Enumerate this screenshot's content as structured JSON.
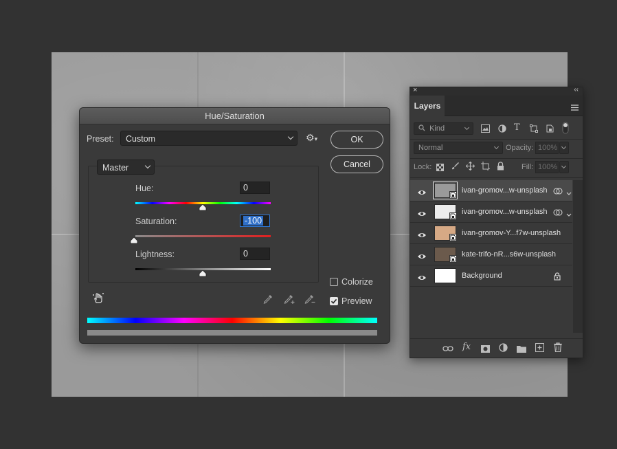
{
  "dialog": {
    "title": "Hue/Saturation",
    "preset_label": "Preset:",
    "preset_value": "Custom",
    "channel_value": "Master",
    "ok_label": "OK",
    "cancel_label": "Cancel",
    "hue_label": "Hue:",
    "hue_value": "0",
    "saturation_label": "Saturation:",
    "saturation_value": "-100",
    "lightness_label": "Lightness:",
    "lightness_value": "0",
    "colorize_label": "Colorize",
    "colorize_checked": false,
    "preview_label": "Preview",
    "preview_checked": true
  },
  "layers_panel": {
    "tab_label": "Layers",
    "filter_kind": "Kind",
    "blend_mode": "Normal",
    "opacity_label": "Opacity:",
    "opacity_value": "100%",
    "lock_label": "Lock:",
    "fill_label": "Fill:",
    "fill_value": "100%",
    "layers": [
      {
        "name": "ivan-gromov...w-unsplash",
        "selected": true,
        "thumb": "#9a9a9a",
        "smart": true,
        "linked": true
      },
      {
        "name": "ivan-gromov...w-unsplash",
        "selected": false,
        "thumb": "#ececec",
        "smart": true,
        "linked": true
      },
      {
        "name": "ivan-gromov-Y...f7w-unsplash",
        "selected": false,
        "thumb": "#d6a985",
        "smart": true,
        "linked": false
      },
      {
        "name": "kate-trifo-nR...s6w-unsplash",
        "selected": false,
        "thumb": "#6b5a4c",
        "smart": true,
        "linked": false
      },
      {
        "name": "Background",
        "selected": false,
        "thumb": "#ffffff",
        "smart": false,
        "linked": false,
        "locked": true
      }
    ]
  },
  "colors": {
    "accent": "#2f6fc8",
    "panel_bg": "#393939",
    "dialog_bg": "#3a3a3a"
  }
}
